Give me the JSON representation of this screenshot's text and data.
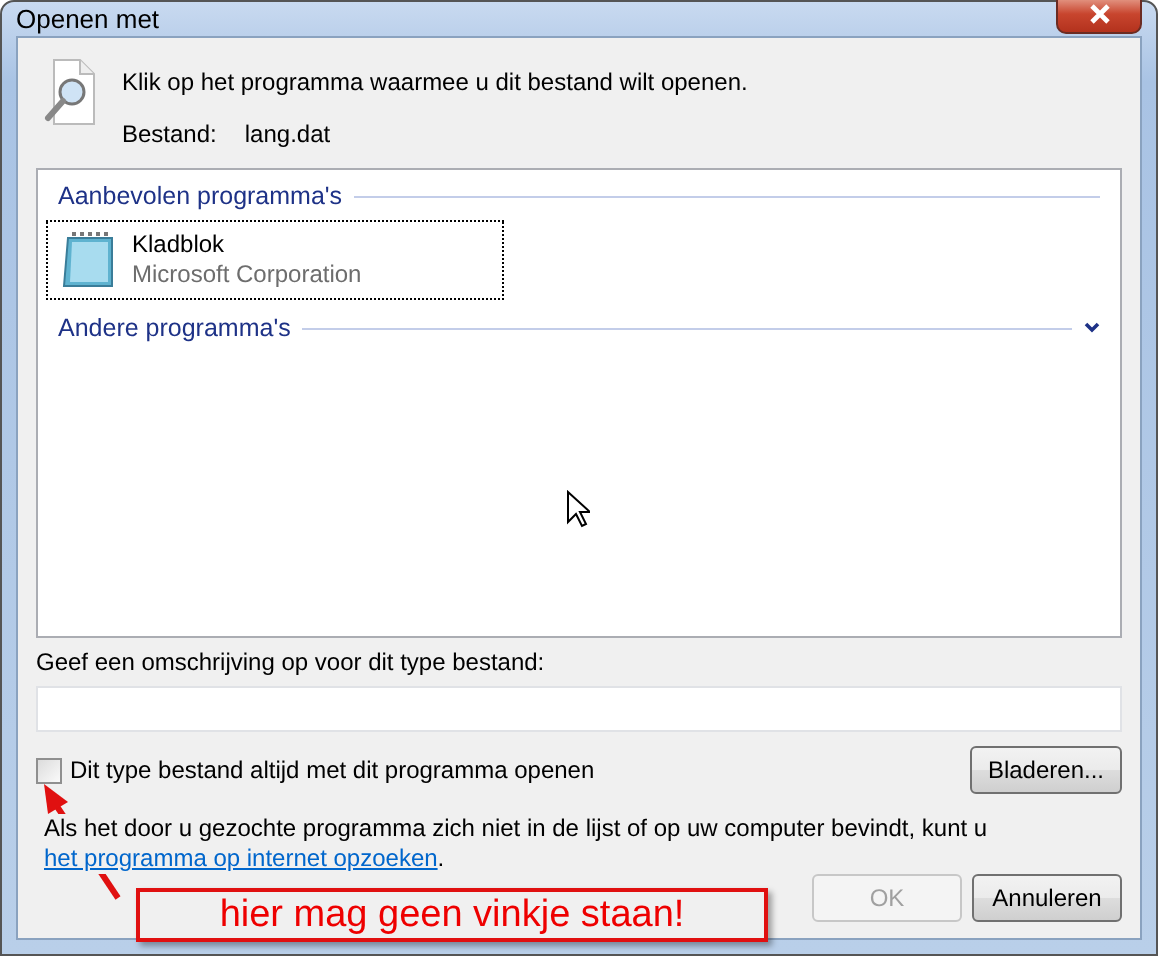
{
  "window": {
    "title": "Openen met"
  },
  "header": {
    "instruction": "Klik op het programma waarmee u dit bestand wilt openen.",
    "file_label": "Bestand:",
    "file_name": "lang.dat"
  },
  "program_groups": [
    {
      "title": "Aanbevolen programma's",
      "expanded": true,
      "programs": [
        {
          "name": "Kladblok",
          "publisher": "Microsoft Corporation",
          "selected": true
        }
      ]
    },
    {
      "title": "Andere programma's",
      "expanded": false
    }
  ],
  "description": {
    "label": "Geef een omschrijving op voor dit type bestand:"
  },
  "always_use": {
    "label": "Dit type bestand altijd met dit programma openen",
    "checked": false
  },
  "browse_button": {
    "label": "Bladeren..."
  },
  "hint": {
    "text": "Als het door u gezochte programma zich niet in de lijst of op uw computer bevindt, kunt u",
    "link": "het programma op internet opzoeken",
    "end": "."
  },
  "buttons": [
    {
      "label": "OK",
      "disabled": true
    },
    {
      "label": "Annuleren",
      "disabled": false
    }
  ],
  "annotation": {
    "text": "hier mag geen vinkje staan!"
  }
}
